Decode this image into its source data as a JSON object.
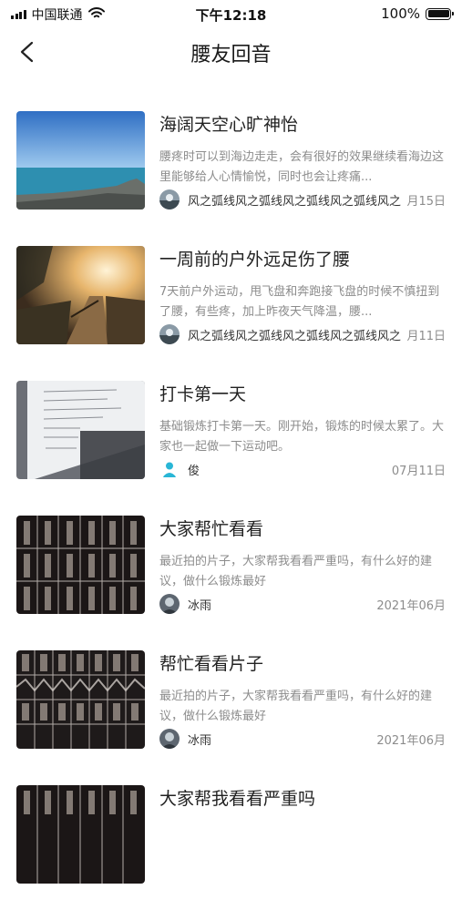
{
  "status_bar": {
    "carrier": "中国联通",
    "time": "下午12:18",
    "battery": "100%"
  },
  "header": {
    "title": "腰友回音",
    "back_icon": "chevron-left-icon"
  },
  "posts": [
    {
      "title": "海阔天空心旷神怡",
      "desc": "腰疼时可以到海边走走，会有很好的效果继续看海边这里能够给人心情愉悦，同时也会让疼痛...",
      "author": "风之弧线风之弧线风之弧线风之弧线风之",
      "date": "月15日",
      "thumb": "sea-photo"
    },
    {
      "title": "一周前的户外远足伤了腰",
      "desc": "7天前户外运动，甩飞盘和奔跑接飞盘的时候不慎扭到了腰，有些疼，加上昨夜天气降温，腰...",
      "author": "风之弧线风之弧线风之弧线风之弧线风之",
      "date": "月11日",
      "thumb": "trail-photo"
    },
    {
      "title": "打卡第一天",
      "desc": "基础锻炼打卡第一天。刚开始，锻炼的时候太累了。大家也一起做一下运动吧。",
      "author": "俊",
      "date": "07月11日",
      "thumb": "paper-photo"
    },
    {
      "title": "大家帮忙看看",
      "desc": "最近拍的片子，大家帮我看看严重吗，有什么好的建议，做什么锻炼最好",
      "author": "冰雨",
      "date": "2021年06月",
      "thumb": "xray-photo"
    },
    {
      "title": "帮忙看看片子",
      "desc": "最近拍的片子，大家帮我看看严重吗，有什么好的建议，做什么锻炼最好",
      "author": "冰雨",
      "date": "2021年06月",
      "thumb": "xray-photo"
    },
    {
      "title": "大家帮我看看严重吗",
      "desc": "",
      "author": "",
      "date": "",
      "thumb": "xray-photo"
    }
  ]
}
